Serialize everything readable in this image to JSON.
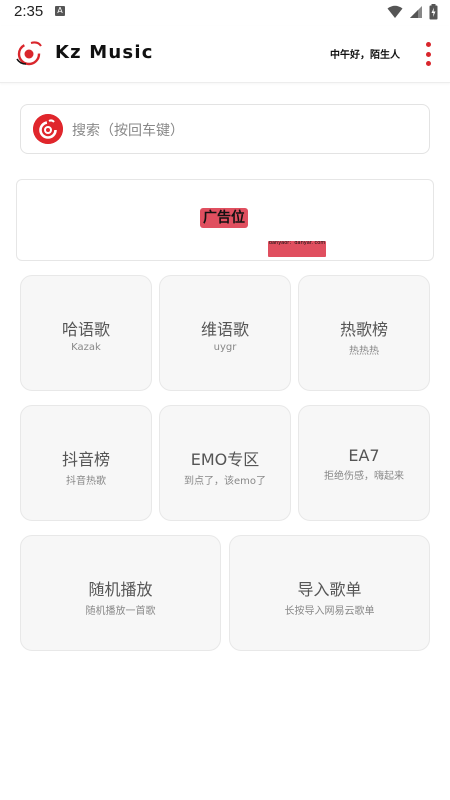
{
  "status_bar": {
    "time": "2:35",
    "notification_icon": "A"
  },
  "app_bar": {
    "title": "Kz Music",
    "greeting": "中午好，陌生人",
    "menu_icon": "more-vert-icon"
  },
  "search": {
    "placeholder": "搜索（按回车键）",
    "icon": "netease-cloud-music-icon"
  },
  "ad": {
    "label": "广告位",
    "sub_text": "danyaor：danyar. com"
  },
  "tiles": [
    {
      "title": "哈语歌",
      "subtitle": "Kazak"
    },
    {
      "title": "维语歌",
      "subtitle": "uygr"
    },
    {
      "title": "热歌榜",
      "subtitle": "热热热"
    },
    {
      "title": "抖音榜",
      "subtitle": "抖音热歌"
    },
    {
      "title": "EMO专区",
      "subtitle": "到点了，该emo了"
    },
    {
      "title": "EA7",
      "subtitle": "拒绝伤感，嗨起来"
    },
    {
      "title": "随机播放",
      "subtitle": "随机播放一首歌"
    },
    {
      "title": "导入歌单",
      "subtitle": "长按导入网易云歌单"
    }
  ],
  "colors": {
    "accent": "#d9262c",
    "card_bg": "#f7f7f7"
  }
}
